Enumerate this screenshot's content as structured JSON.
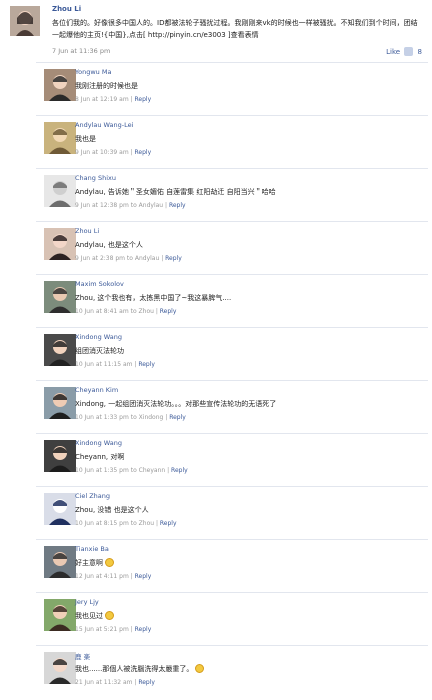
{
  "post": {
    "author": "Zhou Li",
    "body": "各位们我的。好像很多中国人的。ID都被法轮子骚扰过程。我刚刚来vk的时候也一样被骚扰。不知我们到个时间，团结一起爆他的主页!{中国},点击[ http://pinyin.cn/e3003 ]查看表情",
    "date": "7 Jun at 11:36 pm",
    "like_label": "Like",
    "like_count": "8"
  },
  "reply_label": "Reply",
  "replies": [
    {
      "name": "Yongwu Ma",
      "text": "我刚注册的时候也是",
      "date": "8 Jun at 12:19 am",
      "to": ""
    },
    {
      "name": "Andylau Wang-Lei",
      "text": "我也是",
      "date": "9 Jun at 10:39 am",
      "to": ""
    },
    {
      "name": "Chang Shixu",
      "text": "Andylau, 告诉她＂圣女媚佑 自莲雷集 红阳劫迁 自阳当兴＂哈哈",
      "date": "9 Jun at 12:38 pm",
      "to": "Andylau"
    },
    {
      "name": "Zhou Li",
      "text": "Andylau, 也是这个人",
      "date": "9 Jun at 2:38 pm",
      "to": "Andylau"
    },
    {
      "name": "Maxim Sokolov",
      "text": "Zhou, 这个我也有，太拣黑中国了~我这暴脾气....",
      "date": "10 Jun at 8:41 am",
      "to": "Zhou"
    },
    {
      "name": "Xindong Wang",
      "text": "组团消灭法轮功",
      "date": "10 Jun at 11:15 am",
      "to": ""
    },
    {
      "name": "Cheyann Kim",
      "text": "Xindong, 一起组团消灭法轮功。。。对那些宣传法轮功的无语死了",
      "date": "10 Jun at 1:33 pm",
      "to": "Xindong"
    },
    {
      "name": "Xindong Wang",
      "text": "Cheyann, 对啊",
      "date": "10 Jun at 1:35 pm",
      "to": "Cheyann"
    },
    {
      "name": "Ciel Zhang",
      "text": "Zhou, 没错 也是这个人",
      "date": "10 Jun at 8:15 pm",
      "to": "Zhou"
    },
    {
      "name": "Tianxie Ba",
      "text": "好主意啊",
      "date": "12 Jun at 4:11 pm",
      "to": "",
      "emoji": true
    },
    {
      "name": "Jery Ljy",
      "text": "我也见过",
      "date": "15 Jun at 5:21 pm",
      "to": "",
      "emoji": true
    },
    {
      "name": "鹿 楽",
      "text": "我也......那個人被洗腦洗得太嚴重了。",
      "date": "21 Jun at 11:32 am",
      "to": "",
      "emoji": true
    }
  ],
  "to_word": "to"
}
